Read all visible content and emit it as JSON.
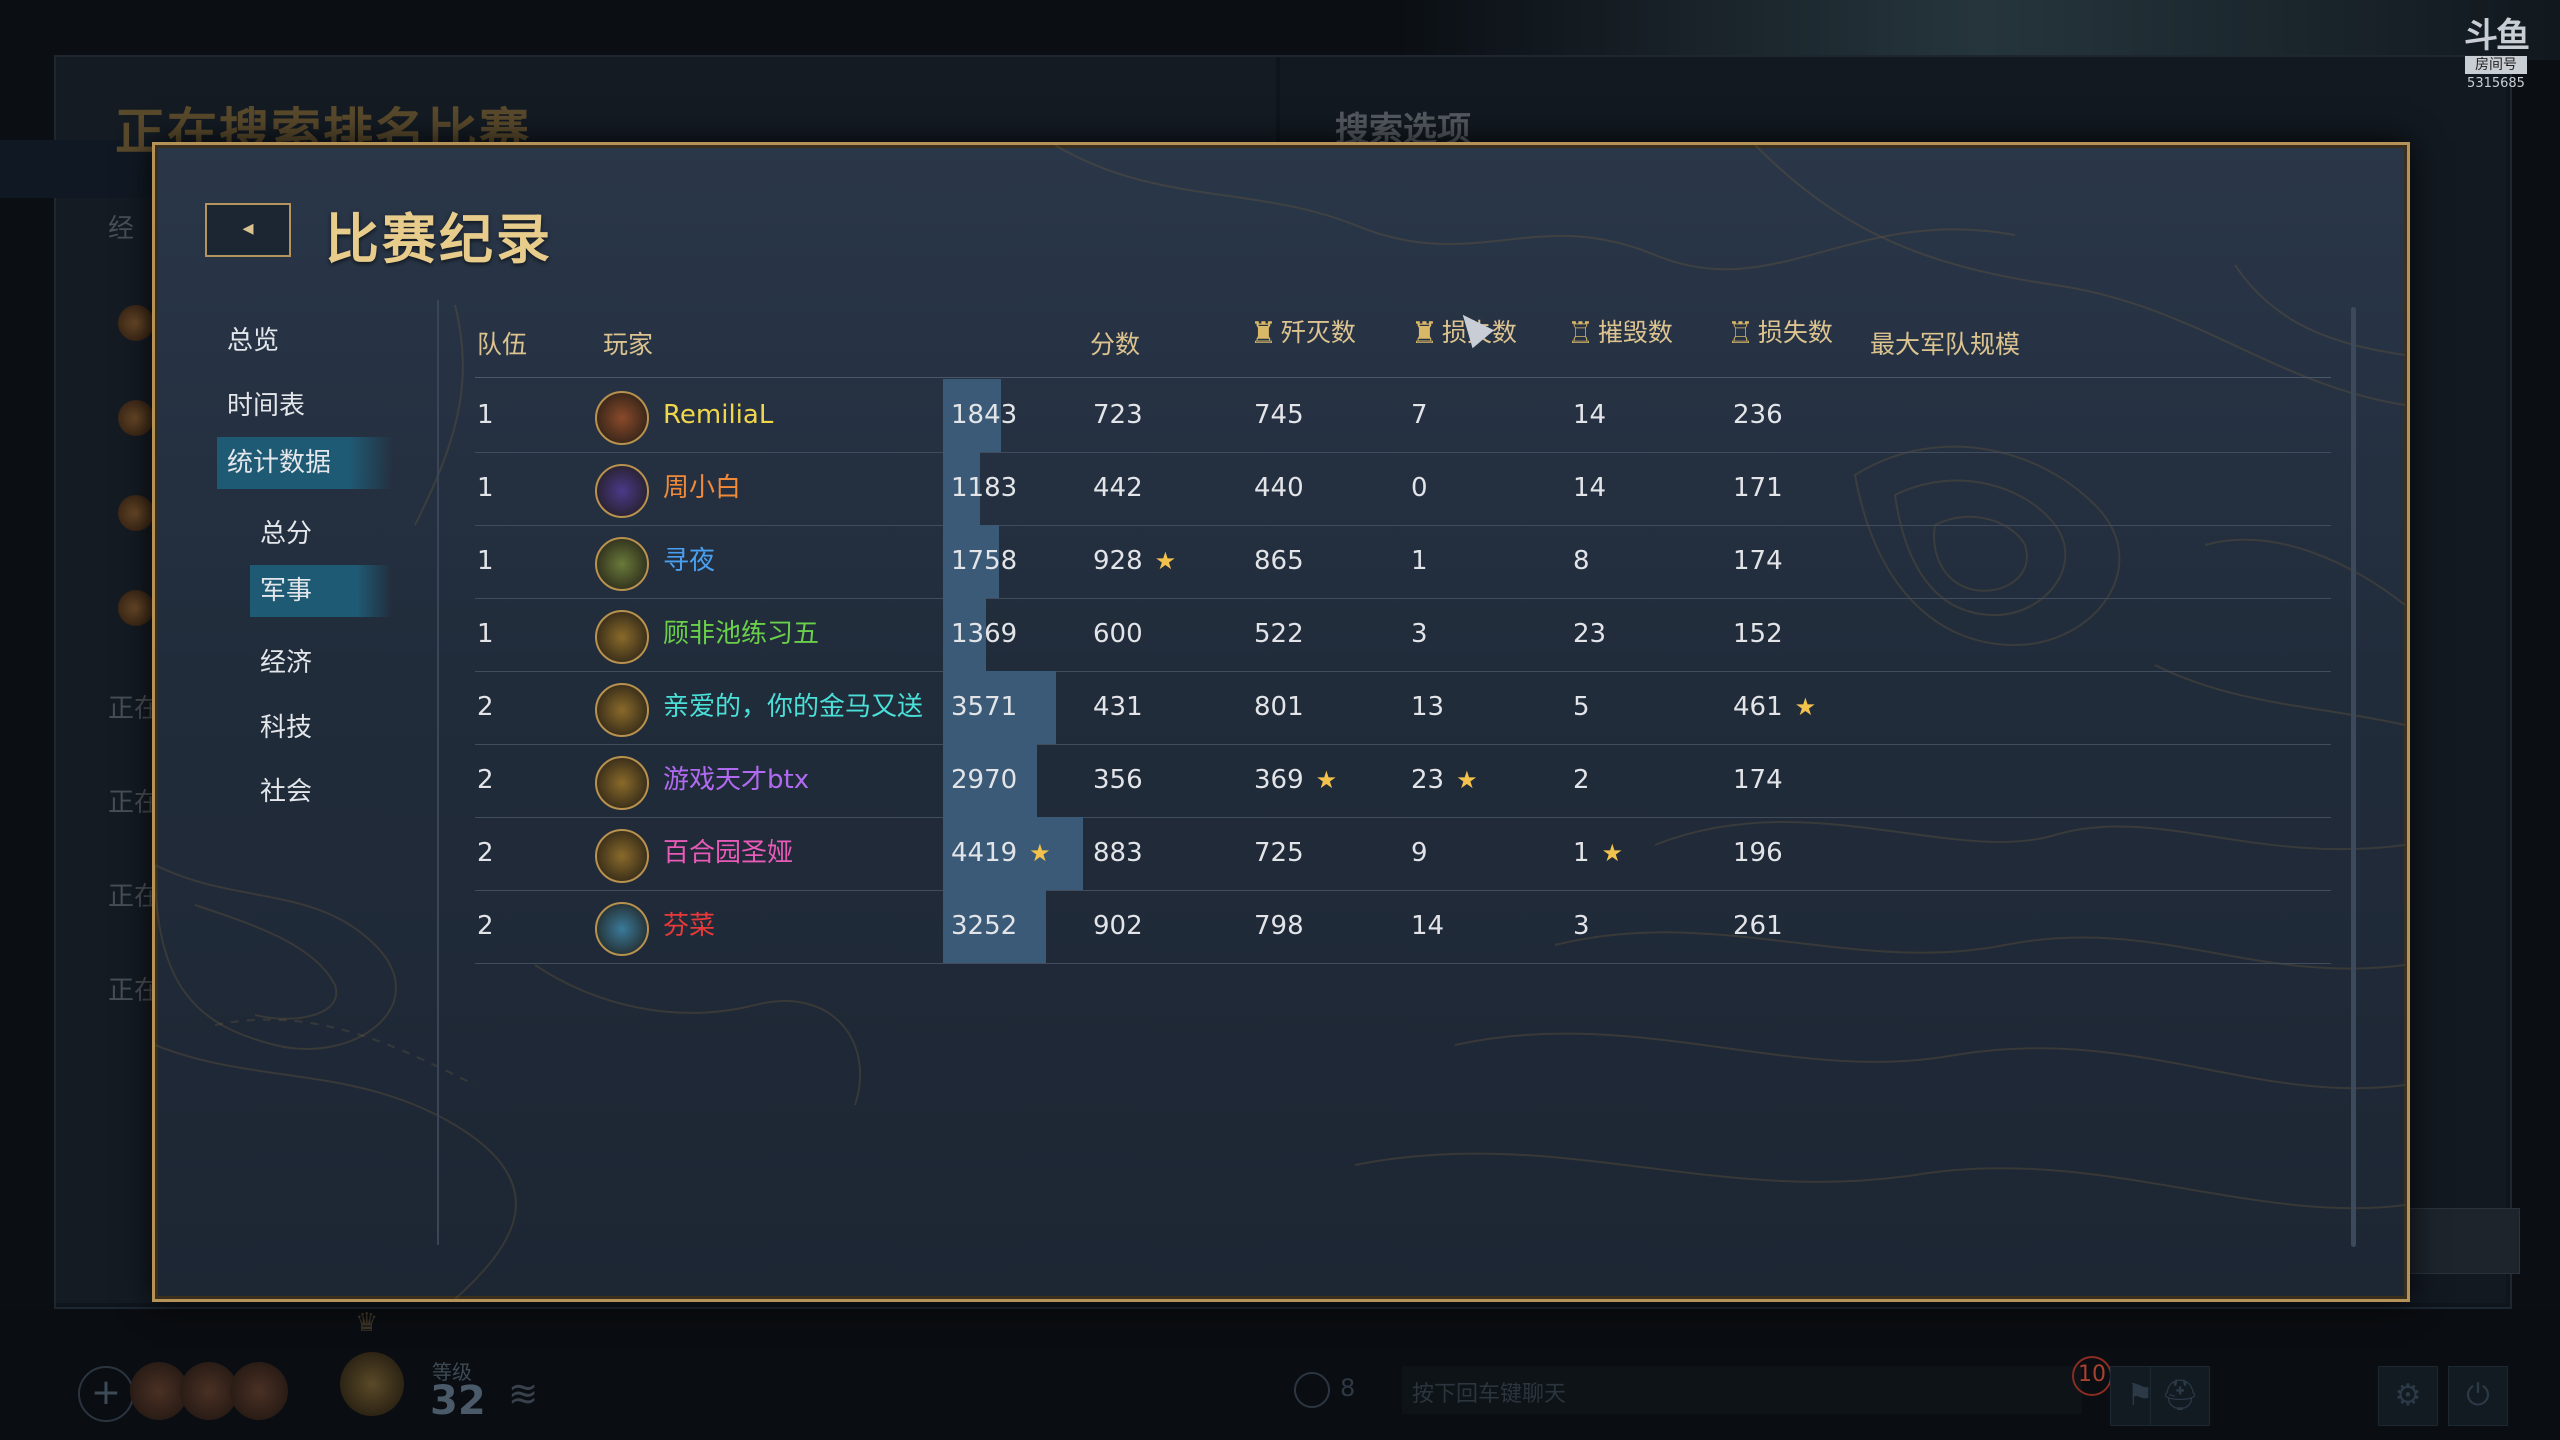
{
  "background": {
    "left_title": "正在搜索排名比赛",
    "right_title": "搜索选项",
    "left_short": "经",
    "row_texts": [
      "正在",
      "正在",
      "正在",
      "正在"
    ]
  },
  "watermark": {
    "logo": "斗鱼",
    "label": "房间号",
    "room": "5315685"
  },
  "modal": {
    "title": "比赛纪录",
    "back_icon": "◂"
  },
  "nav": {
    "items": [
      {
        "label": "总览"
      },
      {
        "label": "时间表"
      },
      {
        "label": "统计数据",
        "selected": true
      },
      {
        "label": "总分",
        "sub": true
      },
      {
        "label": "军事",
        "sub": true,
        "selected": true
      },
      {
        "label": "经济",
        "sub": true
      },
      {
        "label": "科技",
        "sub": true
      },
      {
        "label": "社会",
        "sub": true
      }
    ]
  },
  "table": {
    "headers": {
      "team": "队伍",
      "player": "玩家",
      "score": "分数",
      "kills": "歼灭数",
      "losses": "损失数",
      "destroyed": "摧毁数",
      "lost_buildings": "损失数",
      "max_army": "最大军队规模"
    },
    "max_score": 4419,
    "rows": [
      {
        "team": "1",
        "player": "RemiliaL",
        "color": "#f0d64a",
        "score": "1843",
        "kills": "723",
        "losses": "745",
        "destroyed": "7",
        "lost_buildings": "14",
        "max_army": "236",
        "stars": []
      },
      {
        "team": "1",
        "player": "周小白",
        "color": "#f08a3a",
        "score": "1183",
        "kills": "442",
        "losses": "440",
        "destroyed": "0",
        "lost_buildings": "14",
        "max_army": "171",
        "stars": []
      },
      {
        "team": "1",
        "player": "寻夜",
        "color": "#4aa0f0",
        "score": "1758",
        "kills": "928",
        "losses": "865",
        "destroyed": "1",
        "lost_buildings": "8",
        "max_army": "174",
        "stars": [
          "kills"
        ]
      },
      {
        "team": "1",
        "player": "顾非池练习五",
        "color": "#6ad04a",
        "score": "1369",
        "kills": "600",
        "losses": "522",
        "destroyed": "3",
        "lost_buildings": "23",
        "max_army": "152",
        "stars": []
      },
      {
        "team": "2",
        "player": "亲爱的，你的金马又送",
        "color": "#4ae0d8",
        "score": "3571",
        "kills": "431",
        "losses": "801",
        "destroyed": "13",
        "lost_buildings": "5",
        "max_army": "461",
        "stars": [
          "max_army"
        ]
      },
      {
        "team": "2",
        "player": "游戏天才btx",
        "color": "#b06af0",
        "score": "2970",
        "kills": "356",
        "losses": "369",
        "destroyed": "23",
        "lost_buildings": "2",
        "max_army": "174",
        "stars": [
          "losses",
          "destroyed"
        ]
      },
      {
        "team": "2",
        "player": "百合园圣娅",
        "color": "#e85ab8",
        "score": "4419",
        "kills": "883",
        "losses": "725",
        "destroyed": "9",
        "lost_buildings": "1",
        "max_army": "196",
        "stars": [
          "score",
          "lost_buildings"
        ]
      },
      {
        "team": "2",
        "player": "芬菜",
        "color": "#e83a3a",
        "score": "3252",
        "kills": "902",
        "losses": "798",
        "destroyed": "14",
        "lost_buildings": "3",
        "max_army": "261",
        "stars": []
      }
    ]
  },
  "bottom": {
    "level_label": "等级",
    "level": "32",
    "chat_count": "8",
    "chat_placeholder": "按下回车键聊天",
    "notification": "10"
  },
  "icons": {
    "star": "★",
    "soldier": "soldier-icon",
    "castle": "castle-icon"
  }
}
